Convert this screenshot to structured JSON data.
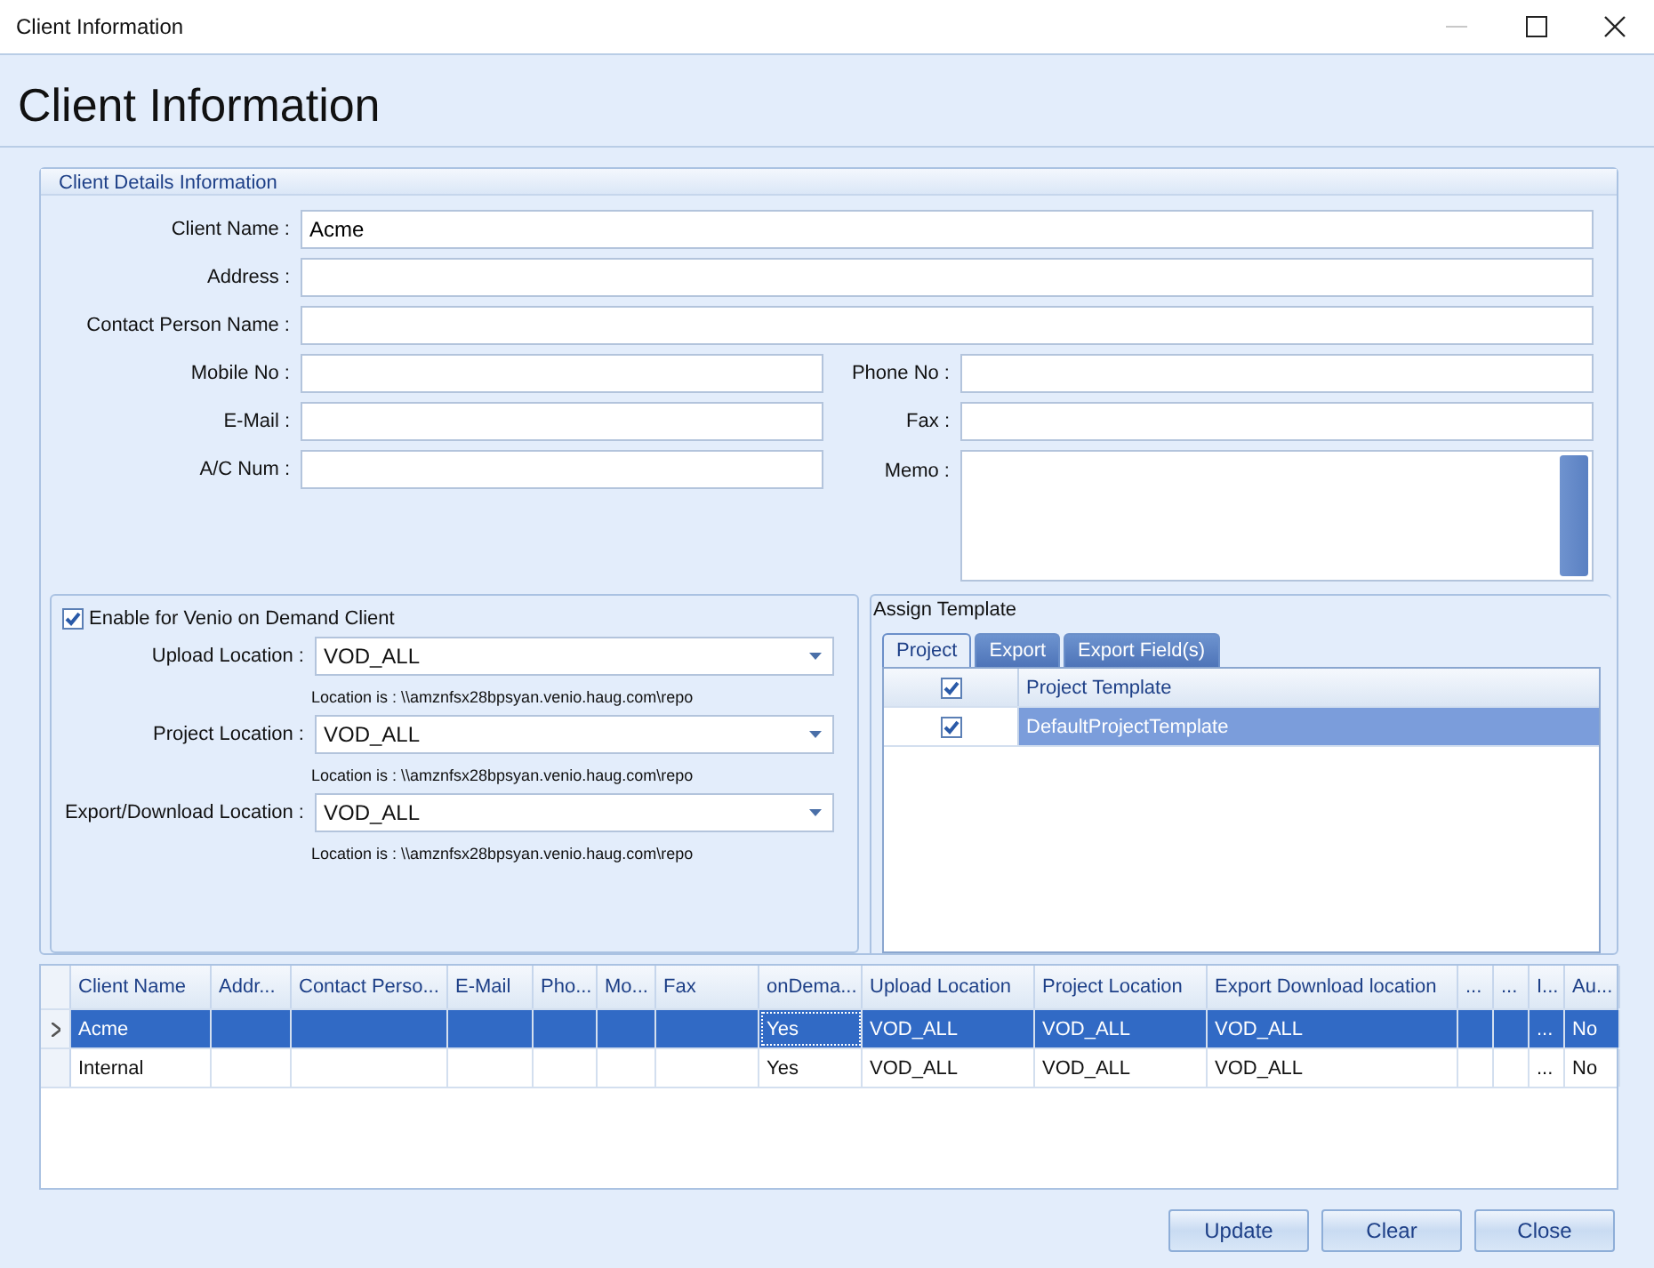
{
  "window": {
    "title": "Client Information"
  },
  "header": {
    "title": "Client Information"
  },
  "details": {
    "legend": "Client Details Information",
    "wide_fields": [
      {
        "label": "Client Name :",
        "value": "Acme"
      },
      {
        "label": "Address :"
      },
      {
        "label": "Contact Person Name :"
      }
    ],
    "left_fields": [
      {
        "label": "Mobile No :"
      },
      {
        "label": "E-Mail :"
      },
      {
        "label": "A/C Num :"
      }
    ],
    "right_fields": [
      {
        "label": "Phone No :",
        "kind": "line"
      },
      {
        "label": "Fax :",
        "kind": "line"
      },
      {
        "label": "Memo :",
        "kind": "memo"
      }
    ]
  },
  "vod": {
    "enabled": true,
    "label": "Enable for Venio on Demand Client",
    "locations": [
      {
        "label": "Upload Location :",
        "value": "VOD_ALL",
        "note": "Location is : \\\\amznfsx28bpsyan.venio.haug.com\\repo"
      },
      {
        "label": "Project Location :",
        "value": "VOD_ALL",
        "note": "Location is : \\\\amznfsx28bpsyan.venio.haug.com\\repo"
      },
      {
        "label": "Export/Download  Location :",
        "value": "VOD_ALL",
        "note": "Location is : \\\\amznfsx28bpsyan.venio.haug.com\\repo"
      }
    ]
  },
  "template": {
    "title": "Assign Template",
    "tabs": [
      {
        "label": "Project",
        "selected": true
      },
      {
        "label": "Export",
        "selected": false
      },
      {
        "label": "Export Field(s)",
        "selected": false
      }
    ],
    "header": {
      "checked": true,
      "label": "Project Template"
    },
    "rows": [
      {
        "checked": true,
        "name": "DefaultProjectTemplate",
        "selected": true
      }
    ]
  },
  "clients": {
    "columns": [
      "Client Name",
      "Addr...",
      "Contact Perso...",
      "E-Mail",
      "Pho...",
      "Mo...",
      "Fax",
      "onDema...",
      "Upload Location",
      "Project Location",
      "Export Download location",
      "...",
      "...",
      "I...",
      "Au..."
    ],
    "rows": [
      {
        "selected": true,
        "cells": [
          "Acme",
          null,
          null,
          null,
          null,
          null,
          null,
          "Yes",
          "VOD_ALL",
          "VOD_ALL",
          "VOD_ALL",
          null,
          null,
          "...",
          "No"
        ]
      },
      {
        "selected": false,
        "cells": [
          "Internal",
          null,
          null,
          null,
          null,
          null,
          null,
          "Yes",
          "VOD_ALL",
          "VOD_ALL",
          "VOD_ALL",
          null,
          null,
          "...",
          "No"
        ]
      }
    ]
  },
  "buttons": [
    "Update",
    "Clear",
    "Close"
  ]
}
